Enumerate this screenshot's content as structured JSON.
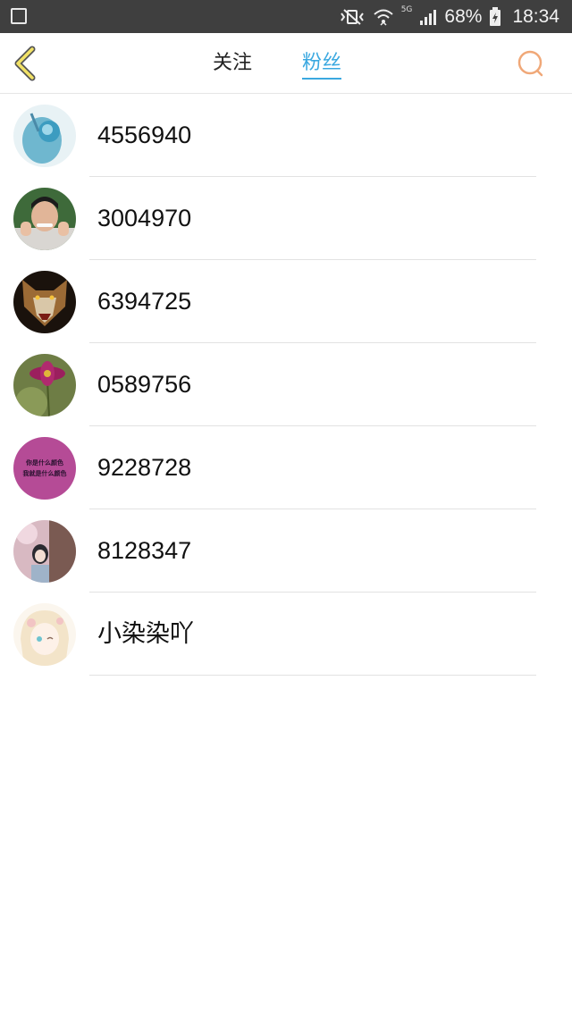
{
  "status_bar": {
    "battery_percent": "68%",
    "time": "18:34",
    "network_label": "5G"
  },
  "nav": {
    "tabs": [
      {
        "label": "关注",
        "active": false
      },
      {
        "label": "粉丝",
        "active": true
      }
    ],
    "accent_color": "#3aa8e0",
    "back_icon": "chevron-left-icon",
    "search_icon": "search-icon"
  },
  "fans": [
    {
      "name": "4556940",
      "avatar": "blue-flower-avatar"
    },
    {
      "name": "3004970",
      "avatar": "man-photo-avatar"
    },
    {
      "name": "6394725",
      "avatar": "wolf-avatar"
    },
    {
      "name": "0589756",
      "avatar": "purple-flower-avatar"
    },
    {
      "name": "9228728",
      "avatar": "pink-text-avatar",
      "avatar_text": [
        "你是什么颜色",
        "我就是什么颜色"
      ]
    },
    {
      "name": "8128347",
      "avatar": "girl-photo-avatar"
    },
    {
      "name": "小染染吖",
      "avatar": "anime-girl-avatar"
    }
  ]
}
